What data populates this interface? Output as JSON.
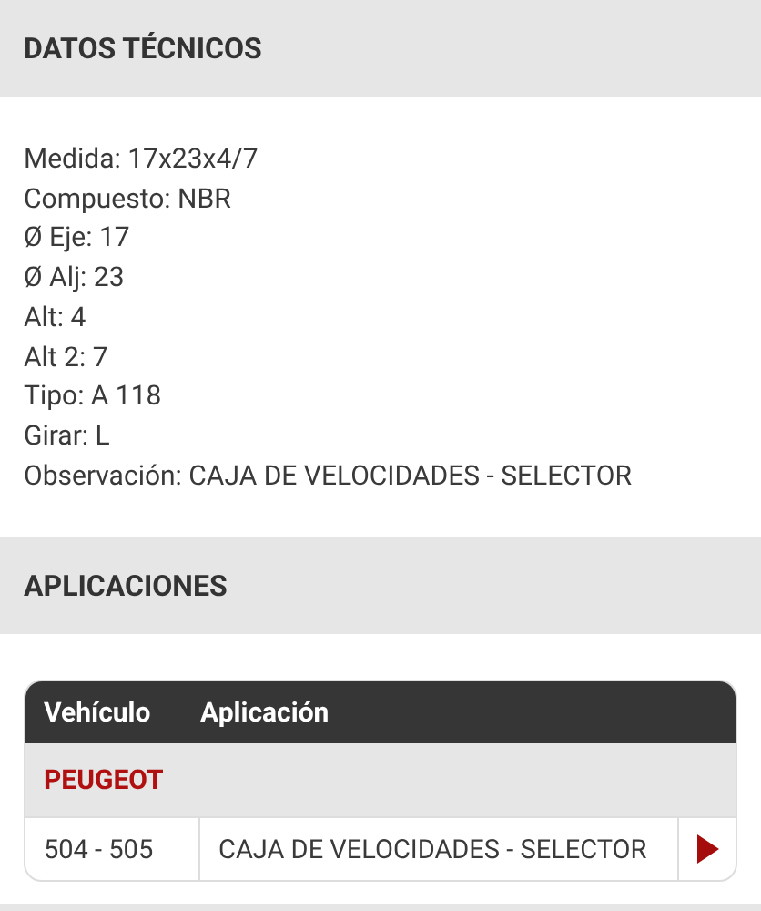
{
  "technical_data": {
    "title": "DATOS TÉCNICOS",
    "specs": [
      "Medida: 17x23x4/7",
      "Compuesto: NBR",
      "Ø Eje: 17",
      "Ø Alj: 23",
      "Alt: 4",
      "Alt 2: 7",
      "Tipo: A 118",
      "Girar: L",
      "Observación: CAJA DE VELOCIDADES - SELECTOR"
    ]
  },
  "applications": {
    "title": "APLICACIONES",
    "table": {
      "columns": [
        "Vehículo",
        "Aplicación"
      ],
      "groups": [
        {
          "brand": "PEUGEOT",
          "rows": [
            {
              "vehicle": "504 - 505",
              "application": "CAJA DE VELOCIDADES - SELECTOR"
            }
          ]
        }
      ]
    }
  }
}
